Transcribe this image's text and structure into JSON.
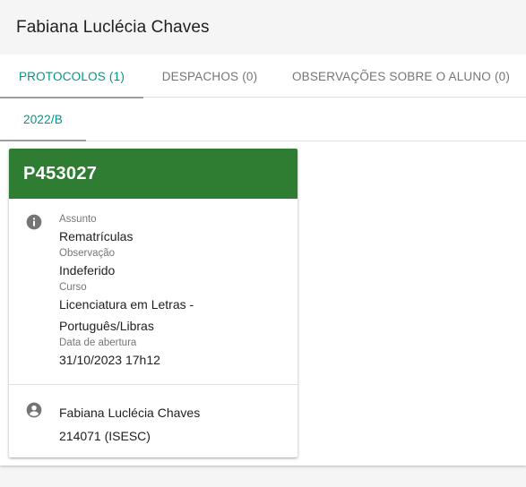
{
  "header": {
    "title": "Fabiana Luclécia Chaves"
  },
  "tabs": [
    {
      "label": "PROTOCOLOS (1)",
      "active": true
    },
    {
      "label": "DESPACHOS (0)",
      "active": false
    },
    {
      "label": "OBSERVAÇÕES SOBRE O ALUNO (0)",
      "active": false
    }
  ],
  "subtabs": [
    {
      "label": "2022/B",
      "active": true
    }
  ],
  "card": {
    "title": "P453027",
    "header_color": "#2e7d32",
    "info_icon": "info-circle-icon",
    "fields": [
      {
        "label": "Assunto",
        "value": "Rematrículas"
      },
      {
        "label": "Observação",
        "value": "Indeferido"
      },
      {
        "label": "Curso",
        "value": "Licenciatura em Letras - Português/Libras"
      },
      {
        "label": "Data de abertura",
        "value": "31/10/2023 17h12"
      }
    ],
    "person": {
      "icon": "account-circle-icon",
      "name": "Fabiana Luclécia Chaves",
      "id": "214071 (ISESC)"
    }
  },
  "colors": {
    "accent": "#009688",
    "card_header": "#2e7d32"
  }
}
